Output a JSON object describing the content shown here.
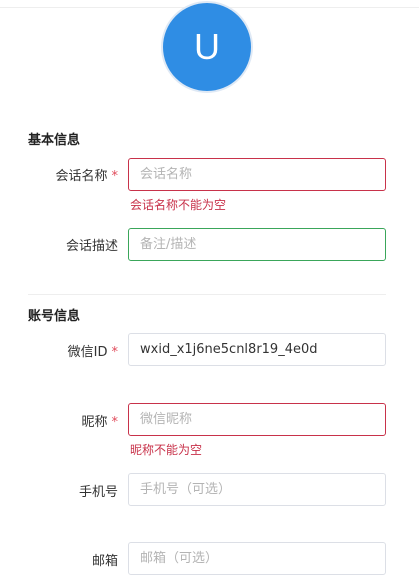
{
  "avatar": {
    "initial": "U"
  },
  "basic": {
    "title": "基本信息",
    "name": {
      "label": "会话名称",
      "required": "*",
      "placeholder": "会话名称",
      "value": "",
      "error": "会话名称不能为空"
    },
    "desc": {
      "label": "会话描述",
      "placeholder": "备注/描述",
      "value": ""
    }
  },
  "account": {
    "title": "账号信息",
    "wxid": {
      "label": "微信ID",
      "required": "*",
      "value": "wxid_x1j6ne5cnl8r19_4e0d"
    },
    "nickname": {
      "label": "昵称",
      "required": "*",
      "placeholder": "微信昵称",
      "value": "",
      "error": "昵称不能为空"
    },
    "phone": {
      "label": "手机号",
      "placeholder": "手机号（可选）",
      "value": ""
    },
    "email": {
      "label": "邮箱",
      "placeholder": "邮箱（可选）",
      "value": ""
    }
  },
  "colors": {
    "primary": "#2f8de4",
    "error": "#c8324a",
    "success": "#3aa65a"
  }
}
